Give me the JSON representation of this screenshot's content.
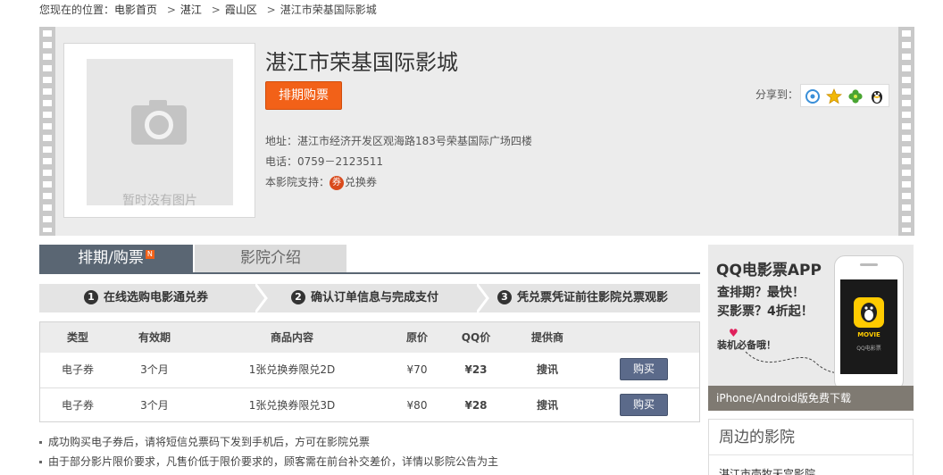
{
  "breadcrumb": {
    "prefix": "您现在的位置：",
    "items": [
      "电影首页",
      "湛江",
      "霞山区",
      "湛江市荣基国际影城"
    ],
    "separator": ">"
  },
  "cinema": {
    "name": "湛江市荣基国际影城",
    "poster_placeholder": "暂时没有图片",
    "buy_button": "排期购票",
    "share_label": "分享到：",
    "share_icons": [
      "weibo-icon",
      "star-icon",
      "clover-icon",
      "qq-penguin-icon"
    ],
    "address": "地址：湛江市经济开发区观海路183号荣基国际广场四楼",
    "phone": "电话：0759－2123511",
    "support_label": "本影院支持：",
    "coupon_icon_text": "券",
    "coupon_text": "兑换券"
  },
  "tabs": [
    {
      "label": "排期/购票",
      "badge": "N",
      "active": true
    },
    {
      "label": "影院介绍",
      "active": false
    }
  ],
  "steps": [
    {
      "num": "1",
      "label": "在线选购电影通兑券"
    },
    {
      "num": "2",
      "label": "确认订单信息与完成支付"
    },
    {
      "num": "3",
      "label": "凭兑票凭证前往影院兑票观影"
    }
  ],
  "table": {
    "headers": [
      "类型",
      "有效期",
      "商品内容",
      "原价",
      "QQ价",
      "提供商"
    ],
    "rows": [
      {
        "type": "电子券",
        "validity": "3个月",
        "content": "1张兑换券限兑2D",
        "price": "¥70",
        "qq_price": "¥23",
        "provider": "搜讯",
        "action": "购买"
      },
      {
        "type": "电子券",
        "validity": "3个月",
        "content": "1张兑换券限兑3D",
        "price": "¥80",
        "qq_price": "¥28",
        "provider": "搜讯",
        "action": "购买"
      }
    ]
  },
  "notes": [
    "成功购买电子券后，请将短信兑票码下发到手机后，方可在影院兑票",
    "由于部分影片限价要求，凡售价低于限价要求的，顾客需在前台补交差价，详情以影院公告为主"
  ],
  "app_ad": {
    "title": "QQ电影票APP",
    "line1": "查排期？最快！",
    "line2": "买影票？4折起！",
    "must_install": "装机必备哦！",
    "phone_badge_text": "QQ电影票",
    "badge_caption": "MOVIE",
    "footer": "iPhone/Android版免费下载"
  },
  "nearby": {
    "title": "周边的影院",
    "first_item": "湛江市壳牧天宫影院"
  },
  "colors": {
    "accent_orange": "#f26118",
    "tab_active_bg": "#5a6673",
    "buy_button_bg": "#5b6a8a"
  }
}
